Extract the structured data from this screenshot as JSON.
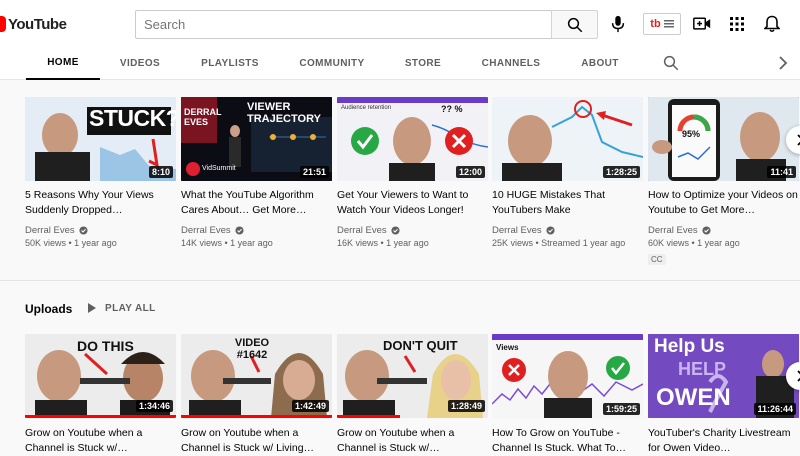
{
  "header": {
    "logo_text": "YouTube",
    "search_placeholder": "Search",
    "extension_label": "tb"
  },
  "tabs": [
    {
      "label": "HOME",
      "active": true
    },
    {
      "label": "VIDEOS",
      "active": false
    },
    {
      "label": "PLAYLISTS",
      "active": false
    },
    {
      "label": "COMMUNITY",
      "active": false
    },
    {
      "label": "STORE",
      "active": false
    },
    {
      "label": "CHANNELS",
      "active": false
    },
    {
      "label": "ABOUT",
      "active": false
    }
  ],
  "featured": [
    {
      "title": "5 Reasons Why Your Views Suddenly Dropped…",
      "channel": "Derral Eves",
      "meta": "50K views • 1 year ago",
      "duration": "8:10",
      "thumb_text": "STUCK?"
    },
    {
      "title": "What the YouTube Algorithm Cares About… Get More…",
      "channel": "Derral Eves",
      "meta": "14K views • 1 year ago",
      "duration": "21:51",
      "thumb_text": "VIEWER TRAJECTORY",
      "thumb_subtext": "DERRAL EVES",
      "thumb_sub2": "VidSummit"
    },
    {
      "title": "Get Your Viewers to Want to Watch Your Videos Longer!",
      "channel": "Derral Eves",
      "meta": "16K views • 1 year ago",
      "duration": "12:00",
      "thumb_text": "Audience retention",
      "thumb_sub2": "?? %"
    },
    {
      "title": "10 HUGE Mistakes That YouTubers Make",
      "channel": "Derral Eves",
      "meta": "25K views • Streamed 1 year ago",
      "duration": "1:28:25"
    },
    {
      "title": "How to Optimize your Videos on Youtube to Get More…",
      "channel": "Derral Eves",
      "meta": "60K views • 1 year ago",
      "duration": "11:41",
      "thumb_text": "95%",
      "badge": "CC"
    }
  ],
  "uploads": {
    "title": "Uploads",
    "play_all": "PLAY ALL",
    "items": [
      {
        "title": "Grow on Youtube when a Channel is Stuck w/…",
        "duration": "1:34:46",
        "thumb_text": "DO THIS",
        "progress": 1.0
      },
      {
        "title": "Grow on Youtube when a Channel is Stuck w/ Living…",
        "duration": "1:42:49",
        "thumb_text": "VIDEO #1642",
        "progress": 1.0
      },
      {
        "title": "Grow on Youtube when a Channel is Stuck w/…",
        "duration": "1:28:49",
        "thumb_text": "DON'T QUIT",
        "progress": 0.42
      },
      {
        "title": "How To Grow on YouTube - Channel Is Stuck. What To…",
        "duration": "1:59:25",
        "thumb_text": "Views",
        "progress": 0
      },
      {
        "title": "YouTuber's Charity Livestream for Owen Video…",
        "duration": "11:26:44",
        "thumb_text": "Help Us",
        "thumb_text2": "HELP",
        "thumb_text3": "OWEN",
        "progress": 0
      }
    ]
  },
  "colors": {
    "accent": "#ff0000",
    "text": "#030303",
    "muted": "#606060",
    "background": "#f9f9f9"
  }
}
